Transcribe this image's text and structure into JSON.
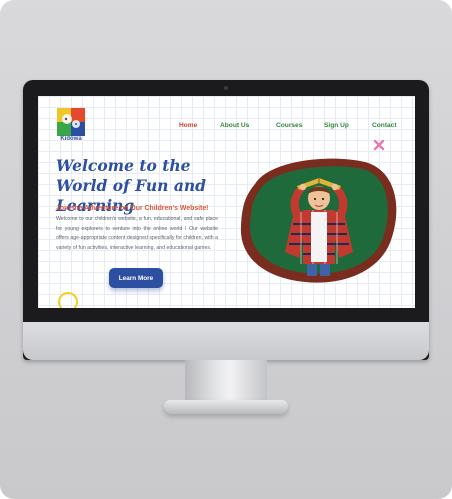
{
  "site": {
    "logo_text": "Kidowa"
  },
  "nav": {
    "items": [
      {
        "label": "Home",
        "active": true
      },
      {
        "label": "About Us",
        "active": false
      },
      {
        "label": "Courses",
        "active": false
      },
      {
        "label": "Sign Up",
        "active": false
      },
      {
        "label": "Contact",
        "active": false
      }
    ]
  },
  "hero": {
    "title": "Welcome to the World of Fun and Learning",
    "subtitle": "Join the Adventure on Our Children's Website!",
    "body": "Welcome to our children's website, a fun, educational, and safe place for young explorers to venture into the online world ! Our website offers age-appropriate content designed specifically for children, with a variety of fun activities, interactive learning, and educational games.",
    "button_label": "Learn More"
  },
  "colors": {
    "brand_blue": "#2d4fa2",
    "nav_active": "#c6442c",
    "nav_link": "#2f8a3c",
    "subtitle": "#d7573a",
    "chalkboard": "#1f6a3a",
    "frame_brown": "#7a2d1f"
  },
  "icons": [
    "logo-mark-icon",
    "x-doodle-icon",
    "ring-doodle-icon"
  ]
}
